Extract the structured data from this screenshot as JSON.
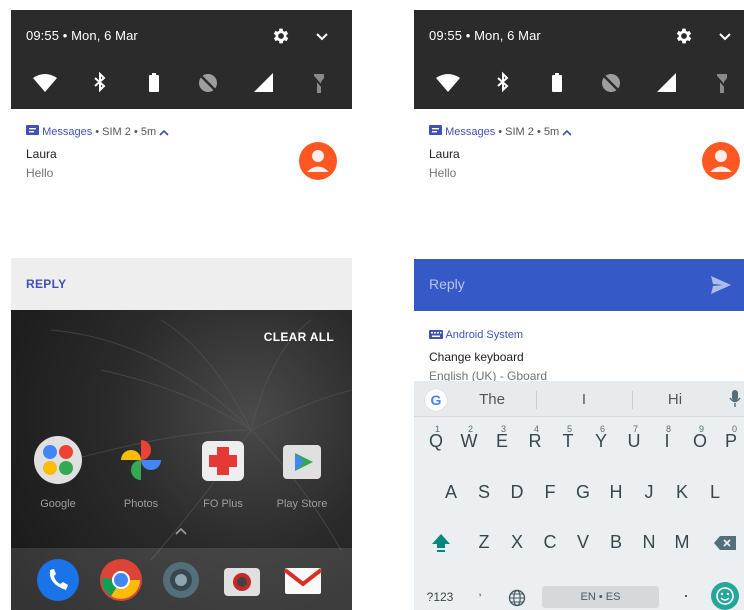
{
  "left": {
    "status": {
      "time": "09:55 • Mon, 6 Mar"
    },
    "notification": {
      "app": "Messages",
      "meta": " • SIM 2 • 5m ",
      "title": "Laura",
      "text": "Hello",
      "reply_label": "REPLY"
    },
    "clear_all": "CLEAR ALL",
    "apps": [
      {
        "label": "Google",
        "icon": "google-folder-icon"
      },
      {
        "label": "Photos",
        "icon": "photos-icon"
      },
      {
        "label": "FO Plus",
        "icon": "first-aid-icon"
      },
      {
        "label": "Play Store",
        "icon": "play-store-icon"
      }
    ],
    "dock": [
      "phone-icon",
      "chrome-icon",
      "camera-settings-icon",
      "camera-icon",
      "gmail-icon"
    ]
  },
  "right": {
    "status": {
      "time": "09:55 • Mon, 6 Mar"
    },
    "notification": {
      "app": "Messages",
      "meta": " • SIM 2 • 5m ",
      "title": "Laura",
      "text": "Hello",
      "reply_placeholder": "Reply"
    },
    "notification2": {
      "app": "Android System",
      "title": "Change keyboard",
      "text": "English (UK) - Gboard"
    },
    "keyboard": {
      "suggestions": [
        "The",
        "I",
        "Hi"
      ],
      "row1": [
        {
          "k": "Q",
          "h": "1"
        },
        {
          "k": "W",
          "h": "2"
        },
        {
          "k": "E",
          "h": "3"
        },
        {
          "k": "R",
          "h": "4"
        },
        {
          "k": "T",
          "h": "5"
        },
        {
          "k": "Y",
          "h": "6"
        },
        {
          "k": "U",
          "h": "7"
        },
        {
          "k": "I",
          "h": "8"
        },
        {
          "k": "O",
          "h": "9"
        },
        {
          "k": "P",
          "h": "0"
        }
      ],
      "row2": [
        "A",
        "S",
        "D",
        "F",
        "G",
        "H",
        "J",
        "K",
        "L"
      ],
      "row3": [
        "Z",
        "X",
        "C",
        "V",
        "B",
        "N",
        "M"
      ],
      "symbols_key": "?123",
      "comma_key": ",",
      "space_label": "EN • ES",
      "period_key": "."
    }
  },
  "colors": {
    "shade": "#2b2b2b",
    "accent": "#3f51b5",
    "reply_bar": "#3559c7",
    "avatar": "#ff5722",
    "keyboard_bg": "#eceff1",
    "emoji_button": "#26a69a"
  }
}
